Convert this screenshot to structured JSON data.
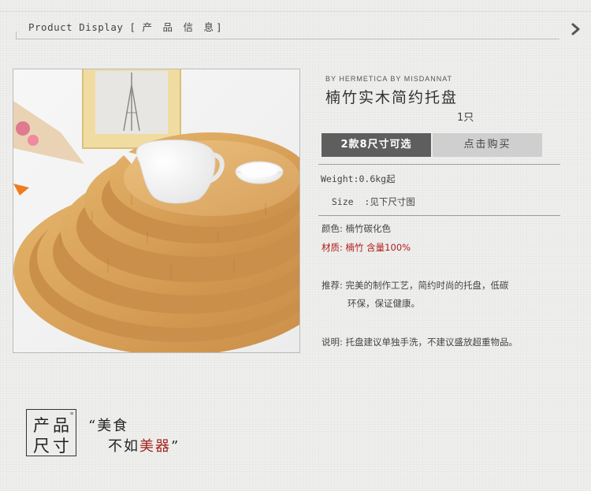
{
  "header": {
    "title_en": "Product Display",
    "title_open": "[",
    "title_zh": "产 品 信 息",
    "title_close": "]",
    "next_icon": "chevron-right-icon"
  },
  "product": {
    "brand": "BY HERMETICA BY MISDANNAT",
    "name": "楠竹实木简约托盘",
    "quantity": "1只",
    "options_button": "2款8尺寸可选",
    "buy_button": "点击购买",
    "specs": [
      {
        "label": "Weight:",
        "value": "0.6kg起"
      },
      {
        "label": "Size  :",
        "value": "见下尺寸图"
      }
    ],
    "color_label": "颜色:",
    "color_value": "楠竹碳化色",
    "material_label": "材质:",
    "material_value": "楠竹 含量100%",
    "recommend_label": "推荐:",
    "recommend_line1": "完美的制作工艺，简约时尚的托盘，低碳",
    "recommend_line2": "环保，保证健康。",
    "note_label": "说明:",
    "note_value": "托盘建议单独手洗，不建议盛放超重物品。"
  },
  "footer": {
    "logo_chars": [
      "产",
      "品",
      "尺",
      "寸"
    ],
    "logo_mark": "°",
    "quote_open": "“",
    "quote_line1": "美食",
    "quote_line2_a": "不如",
    "quote_line2_b": "美器",
    "quote_close": "”"
  },
  "colors": {
    "accent_red": "#b11b1b",
    "button_dark": "#5e5e5e",
    "button_light": "#cfcfcf"
  }
}
